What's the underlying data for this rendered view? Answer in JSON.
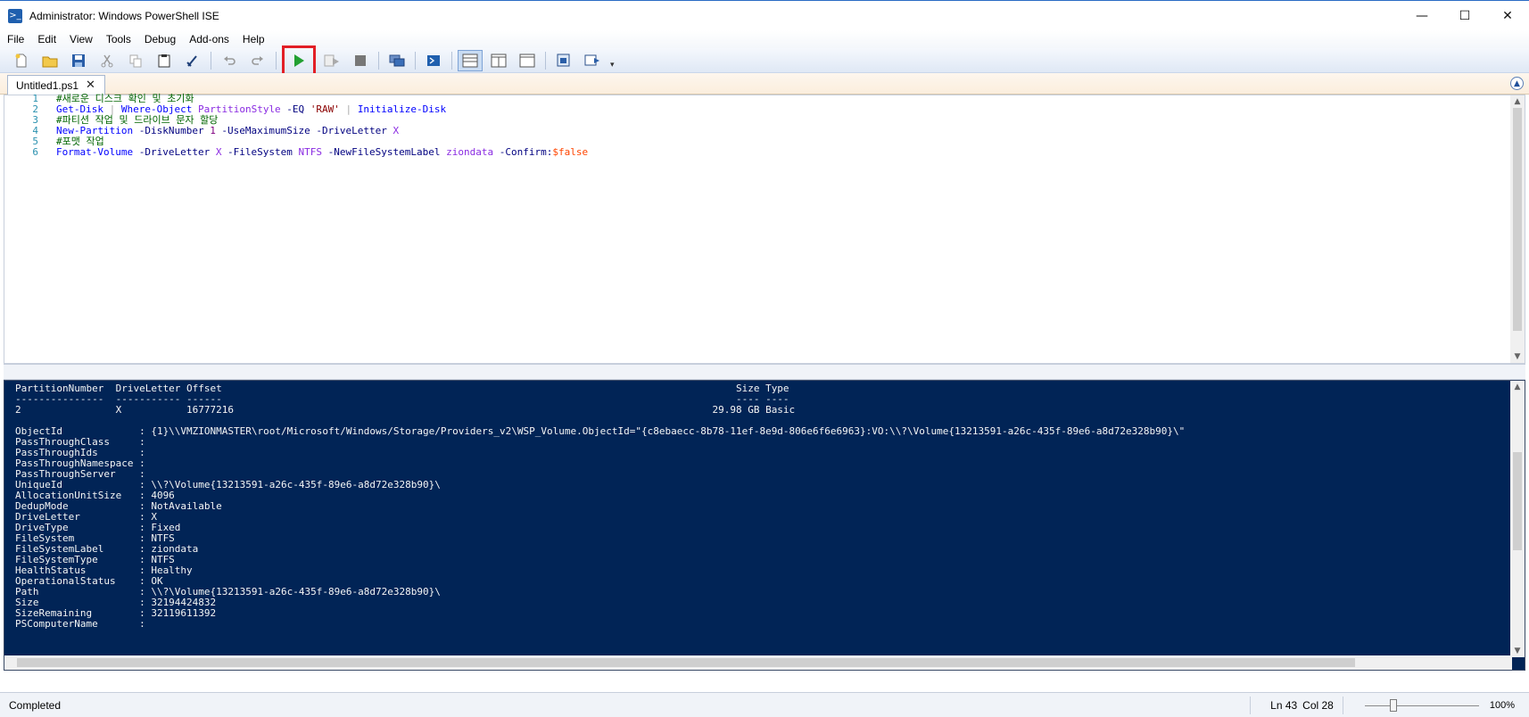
{
  "window": {
    "title": "Administrator: Windows PowerShell ISE",
    "icon": "powershell-icon",
    "controls": {
      "minimize": "—",
      "maximize": "☐",
      "close": "✕"
    }
  },
  "menu": [
    "File",
    "Edit",
    "View",
    "Tools",
    "Debug",
    "Add-ons",
    "Help"
  ],
  "toolbar": {
    "buttons": [
      "new-script",
      "open",
      "save",
      "cut",
      "copy",
      "paste",
      "clear-console",
      "undo",
      "redo",
      "run-script",
      "run-selection",
      "stop",
      "new-remote-tab",
      "start-powershell",
      "show-script-top",
      "show-script-right",
      "show-script-maximized",
      "show-command-window",
      "show-command-addon"
    ],
    "highlighted": "run-script",
    "highlight_color": "#e21f26"
  },
  "tabs": [
    {
      "label": "Untitled1.ps1",
      "close": "✕"
    }
  ],
  "editor": {
    "lines": [
      {
        "n": "1",
        "tokens": [
          {
            "t": "#새로운 디스크 확인 및 초기화",
            "c": "t-comment"
          }
        ]
      },
      {
        "n": "2",
        "tokens": [
          {
            "t": "Get-Disk",
            "c": "t-cmd"
          },
          {
            "t": " | ",
            "c": "t-op"
          },
          {
            "t": "Where-Object",
            "c": "t-cmd"
          },
          {
            "t": " ",
            "c": "t-type"
          },
          {
            "t": "PartitionStyle",
            "c": "t-arg"
          },
          {
            "t": " -EQ ",
            "c": "t-param"
          },
          {
            "t": "'RAW'",
            "c": "t-str"
          },
          {
            "t": " | ",
            "c": "t-op"
          },
          {
            "t": "Initialize-Disk",
            "c": "t-cmd"
          }
        ]
      },
      {
        "n": "3",
        "tokens": [
          {
            "t": "#파티션 작업 및 드라이브 문자 할당",
            "c": "t-comment"
          }
        ]
      },
      {
        "n": "4",
        "tokens": [
          {
            "t": "New-Partition",
            "c": "t-cmd"
          },
          {
            "t": " -DiskNumber ",
            "c": "t-param"
          },
          {
            "t": "1",
            "c": "t-num"
          },
          {
            "t": " -UseMaximumSize -DriveLetter ",
            "c": "t-param"
          },
          {
            "t": "X",
            "c": "t-arg"
          }
        ]
      },
      {
        "n": "5",
        "tokens": [
          {
            "t": "#포맷 작업",
            "c": "t-comment"
          }
        ]
      },
      {
        "n": "6",
        "tokens": [
          {
            "t": "Format-Volume",
            "c": "t-cmd"
          },
          {
            "t": " -DriveLetter ",
            "c": "t-param"
          },
          {
            "t": "X",
            "c": "t-arg"
          },
          {
            "t": " -FileSystem ",
            "c": "t-param"
          },
          {
            "t": "NTFS",
            "c": "t-arg"
          },
          {
            "t": " -NewFileSystemLabel ",
            "c": "t-param"
          },
          {
            "t": "ziondata",
            "c": "t-arg"
          },
          {
            "t": " -Confirm:",
            "c": "t-param"
          },
          {
            "t": "$false",
            "c": "t-var"
          }
        ]
      }
    ]
  },
  "console": {
    "lines": [
      "PartitionNumber  DriveLetter Offset                                                                                       Size Type",
      "---------------  ----------- ------                                                                                       ---- ----",
      "2                X           16777216                                                                                 29.98 GB Basic",
      "",
      "ObjectId             : {1}\\\\VMZIONMASTER\\root/Microsoft/Windows/Storage/Providers_v2\\WSP_Volume.ObjectId=\"{c8ebaecc-8b78-11ef-8e9d-806e6f6e6963}:VO:\\\\?\\Volume{13213591-a26c-435f-89e6-a8d72e328b90}\\\"",
      "PassThroughClass     :",
      "PassThroughIds       :",
      "PassThroughNamespace :",
      "PassThroughServer    :",
      "UniqueId             : \\\\?\\Volume{13213591-a26c-435f-89e6-a8d72e328b90}\\",
      "AllocationUnitSize   : 4096",
      "DedupMode            : NotAvailable",
      "DriveLetter          : X",
      "DriveType            : Fixed",
      "FileSystem           : NTFS",
      "FileSystemLabel      : ziondata",
      "FileSystemType       : NTFS",
      "HealthStatus         : Healthy",
      "OperationalStatus    : OK",
      "Path                 : \\\\?\\Volume{13213591-a26c-435f-89e6-a8d72e328b90}\\",
      "Size                 : 32194424832",
      "SizeRemaining        : 32119611392",
      "PSComputerName       :"
    ]
  },
  "status": {
    "text": "Completed",
    "line": "Ln 43",
    "col": "Col 28",
    "zoom": "100%"
  }
}
